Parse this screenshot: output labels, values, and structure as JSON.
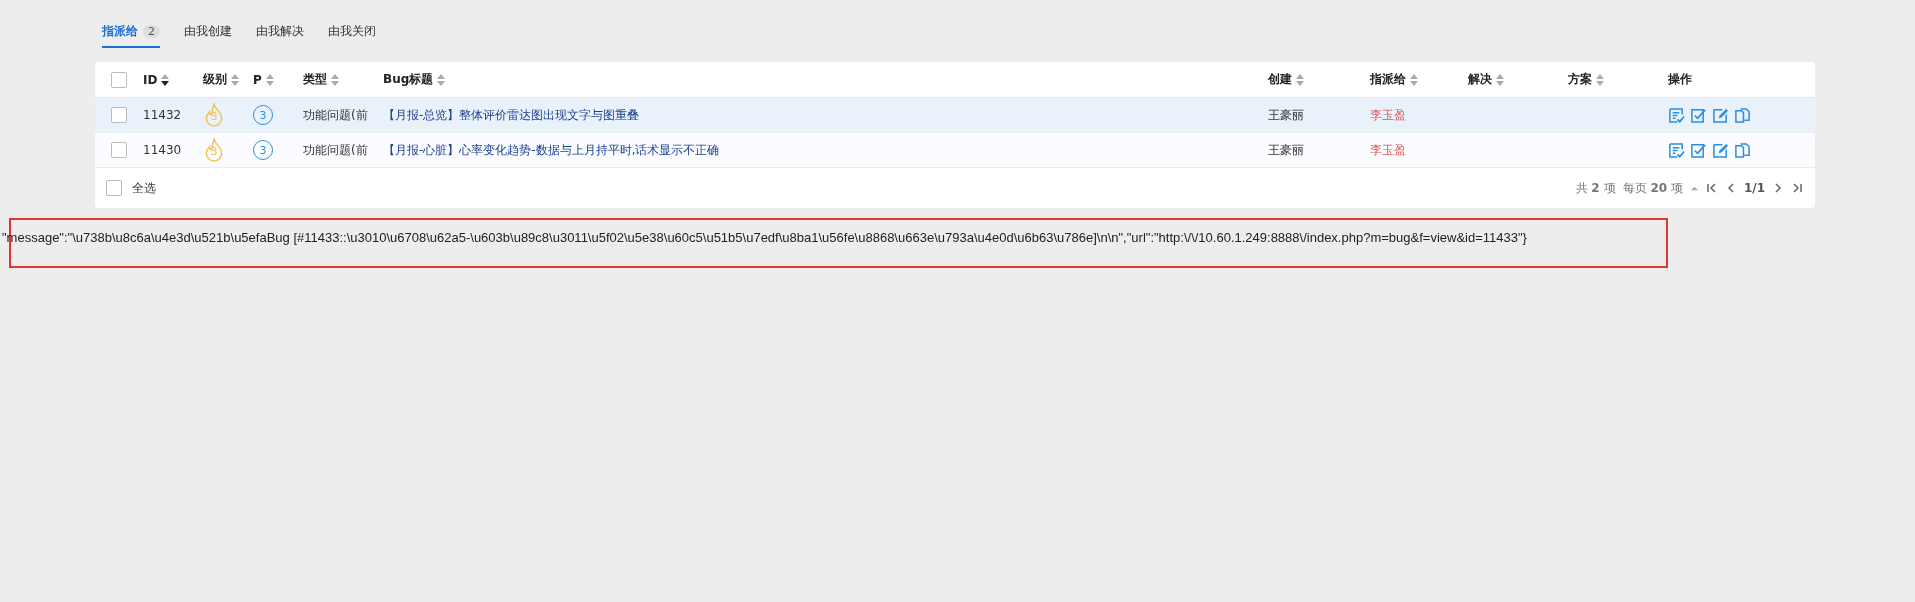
{
  "tabs": [
    {
      "label": "指派给",
      "count": "2",
      "selected": true
    },
    {
      "label": "由我创建",
      "selected": false
    },
    {
      "label": "由我解决",
      "selected": false
    },
    {
      "label": "由我关闭",
      "selected": false
    }
  ],
  "table": {
    "columns": [
      {
        "label": "ID",
        "sorted": true
      },
      {
        "label": "级别",
        "sorted": false
      },
      {
        "label": "P",
        "sorted": false
      },
      {
        "label": "类型",
        "sorted": false
      },
      {
        "label": "Bug标题",
        "sorted": false
      },
      {
        "label": "创建",
        "sorted": false
      },
      {
        "label": "指派给",
        "sorted": false
      },
      {
        "label": "解决",
        "sorted": false
      },
      {
        "label": "方案",
        "sorted": false
      },
      {
        "label": "操作"
      }
    ],
    "header_checked": false,
    "rows": [
      {
        "checked": false,
        "selected": true,
        "id": "11432",
        "severity": "3",
        "pri": "3",
        "type": "功能问题(前",
        "title": "【月报-总览】整体评价雷达图出现文字与图重叠",
        "creator": "王豪丽",
        "assignee": "李玉盈"
      },
      {
        "checked": false,
        "selected": false,
        "id": "11430",
        "severity": "3",
        "pri": "3",
        "type": "功能问题(前",
        "title": "【月报-心脏】心率变化趋势-数据与上月持平时,话术显示不正确",
        "creator": "王豪丽",
        "assignee": "李玉盈"
      }
    ],
    "footer": {
      "select_all": {
        "label": "全选",
        "checked": false
      },
      "total": "共 **2** 项",
      "per_page": "每页 **20** 项",
      "page": "1/1"
    }
  },
  "message": "\"message\":\"\\u738b\\u8c6a\\u4e3d\\u521b\\u5efaBug [#11433::\\u3010\\u6708\\u62a5-\\u603b\\u89c8\\u3011\\u5f02\\u5e38\\u60c5\\u51b5\\u7edf\\u8ba1\\u56fe\\u8868\\u663e\\u793a\\u4e0d\\u6b63\\u786e]\\n\\n\",\"url\":\"http:\\/\\/10.60.1.249:8888\\/index.php?m=bug&f=view&id=11433\"}"
}
